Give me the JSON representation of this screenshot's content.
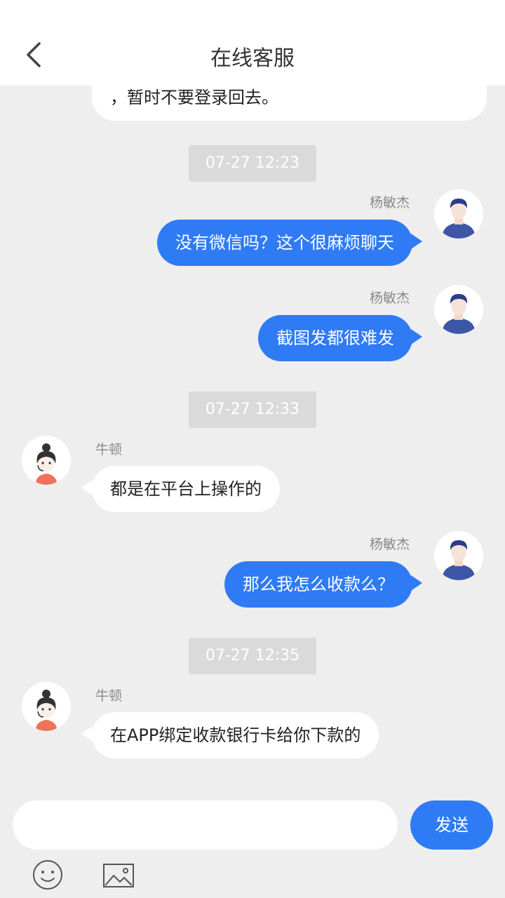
{
  "header": {
    "title": "在线客服"
  },
  "chat": {
    "partial_message": "，暂时不要登录回去。",
    "timestamps": [
      "07-27 12:23",
      "07-27 12:33",
      "07-27 12:35"
    ],
    "messages": [
      {
        "sender": "杨敏杰",
        "text": "没有微信吗？这个很麻烦聊天",
        "direction": "out"
      },
      {
        "sender": "杨敏杰",
        "text": "截图发都很难发",
        "direction": "out"
      },
      {
        "sender": "牛顿",
        "text": "都是在平台上操作的",
        "direction": "in"
      },
      {
        "sender": "杨敏杰",
        "text": "那么我怎么收款么？",
        "direction": "out"
      },
      {
        "sender": "牛顿",
        "text": "在APP绑定收款银行卡给你下款的",
        "direction": "in"
      }
    ]
  },
  "composer": {
    "input_value": "",
    "send_label": "发送"
  },
  "icons": {
    "back": "chevron-left-icon",
    "emoji": "smiley-icon",
    "image": "image-icon",
    "user_avatar": "male-avatar-icon",
    "agent_avatar": "female-agent-avatar-icon"
  },
  "colors": {
    "accent": "#2f7bf6",
    "background": "#eeeeee",
    "timestamp_bg": "#dadada"
  }
}
